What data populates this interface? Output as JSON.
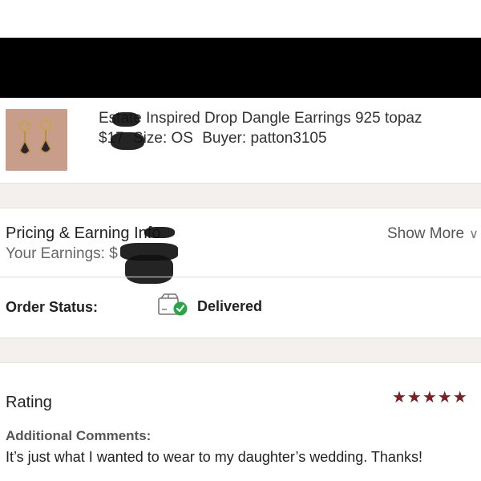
{
  "product": {
    "title": "Estate Inspired Drop Dangle Earrings 925 topaz",
    "price": "$17",
    "size": "Size: OS",
    "buyer": "Buyer: patton3105",
    "thumbnail_icon": "earrings-photo"
  },
  "pricing": {
    "title": "Pricing & Earning Info",
    "earnings_label": "Your Earnings: $",
    "show_more": "Show More"
  },
  "order": {
    "label": "Order Status:",
    "value": "Delivered",
    "status_color": "#27a644"
  },
  "rating": {
    "title": "Rating",
    "stars": "★★★★★",
    "star_color": "#7a2020",
    "comments_label": "Additional Comments:",
    "comments_text": "It’s just what I wanted to wear to my daughter’s wedding. Thanks!"
  }
}
